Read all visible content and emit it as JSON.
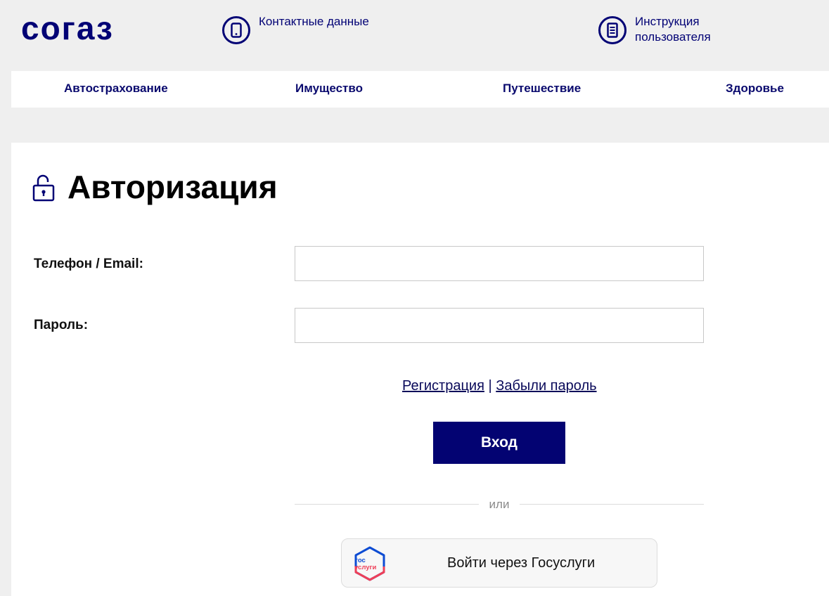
{
  "header": {
    "logo_text": "согаз",
    "contacts_label": "Контактные данные",
    "manual_label": "Инструкция пользователя"
  },
  "nav": {
    "items": [
      "Автострахование",
      "Имущество",
      "Путешествие",
      "Здоровье"
    ]
  },
  "auth": {
    "title": "Авторизация",
    "phone_label": "Телефон / Email:",
    "phone_value": "",
    "password_label": "Пароль:",
    "password_value": "",
    "register_link": "Регистрация",
    "separator": "|",
    "forgot_link": "Забыли пароль",
    "login_button": "Вход",
    "or_text": "или",
    "gosuslugi_button": "Войти через Госуслуги",
    "gos_logo_line1": "гос",
    "gos_logo_line2": "услуги"
  },
  "colors": {
    "brand": "#020275",
    "page_bg": "#efefef",
    "gos_blue": "#0d4cd3",
    "gos_red": "#ee3f58"
  }
}
